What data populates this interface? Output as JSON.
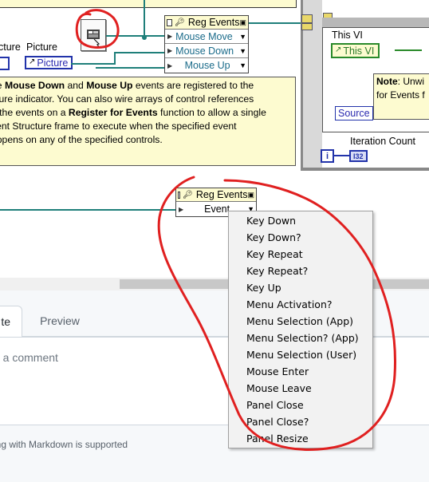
{
  "diagram": {
    "labels": {
      "cut_label": "cture",
      "picture_label": "Picture",
      "picture_control": "Picture"
    },
    "reg_events_top": {
      "title": "Reg Events",
      "rows": [
        "Mouse Move",
        "Mouse Down",
        "Mouse Up"
      ]
    },
    "note_lines": [
      [
        "he ",
        {
          "b": "Mouse Down"
        },
        " and ",
        {
          "b": "Mouse Up"
        },
        " events are registered to the"
      ],
      [
        "cture indicator. You can also wire arrays of control references"
      ],
      [
        "o the events on a ",
        {
          "b": "Register for Events"
        },
        " function to allow a single"
      ],
      [
        "vent Structure frame to execute when the specified event"
      ],
      [
        "appens on any of the specified controls."
      ]
    ],
    "vi_panel": {
      "this_vi_label": "This VI",
      "this_vi_control": "This VI",
      "note_bold": "Note",
      "note_line1": ": Unwi",
      "note_line2": "for Events f",
      "source_label": "Source",
      "iteration_label": "Iteration Count",
      "i_glyph": "i",
      "i32_glyph": "I32"
    },
    "reg_events_bottom": {
      "title": "Reg Events",
      "row": "Event"
    }
  },
  "comment_panel": {
    "tab_write": "te",
    "tab_preview": "Preview",
    "placeholder": "e a comment",
    "markdown_hint": "ing with Markdown is supported"
  },
  "menu": {
    "items": [
      "Key Down",
      "Key Down?",
      "Key Repeat",
      "Key Repeat?",
      "Key Up",
      "Menu Activation?",
      "Menu Selection (App)",
      "Menu Selection? (App)",
      "Menu Selection (User)",
      "Mouse Enter",
      "Mouse Leave",
      "Panel Close",
      "Panel Close?",
      "Panel Resize"
    ]
  },
  "colors": {
    "note_bg": "#fdfbd0",
    "wire": "#1f7f7a",
    "control_blue": "#2233aa",
    "annotation_red": "#e02020"
  },
  "icons": {
    "picture_file": "picture-file-icon",
    "reference": "reference-icon",
    "dropdown": "dropdown-arrow-icon"
  }
}
